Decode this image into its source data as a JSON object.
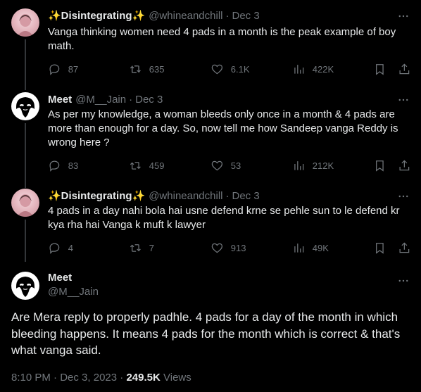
{
  "tweets": [
    {
      "name": "✨Disintegrating✨",
      "handle": "@whineandchill",
      "date": "Dec 3",
      "text": "Vanga thinking women need 4 pads in a month is the peak example of boy math.",
      "replies": "87",
      "retweets": "635",
      "likes": "6.1K",
      "views": "422K",
      "avatar_icon": "profile-photo"
    },
    {
      "name": "Meet",
      "handle": "@M__Jain",
      "date": "Dec 3",
      "text": "As per my knowledge, a woman bleeds only once in a month & 4 pads are more than enough for a day. So, now tell me how Sandeep vanga Reddy is wrong here ?",
      "replies": "83",
      "retweets": "459",
      "likes": "53",
      "views": "212K",
      "avatar_icon": "mask-avatar"
    },
    {
      "name": "✨Disintegrating✨",
      "handle": "@whineandchill",
      "date": "Dec 3",
      "text": "4 pads in a day nahi bola hai usne defend krne se pehle sun to le defend kr kya rha hai Vanga k muft k lawyer",
      "replies": "4",
      "retweets": "7",
      "likes": "913",
      "views": "49K",
      "avatar_icon": "profile-photo"
    }
  ],
  "main": {
    "name": "Meet",
    "handle": "@M__Jain",
    "text": "Are Mera reply to properly padhle. 4 pads for a day of the month in which bleeding happens. It means 4 pads for the month which is correct & that's what vanga said.",
    "time": "8:10 PM",
    "date": "Dec 3, 2023",
    "views": "249.5K",
    "views_label": "Views"
  },
  "colors": {
    "background": "#000000",
    "text": "#e7e9ea",
    "muted": "#71767b",
    "line": "#333639"
  }
}
